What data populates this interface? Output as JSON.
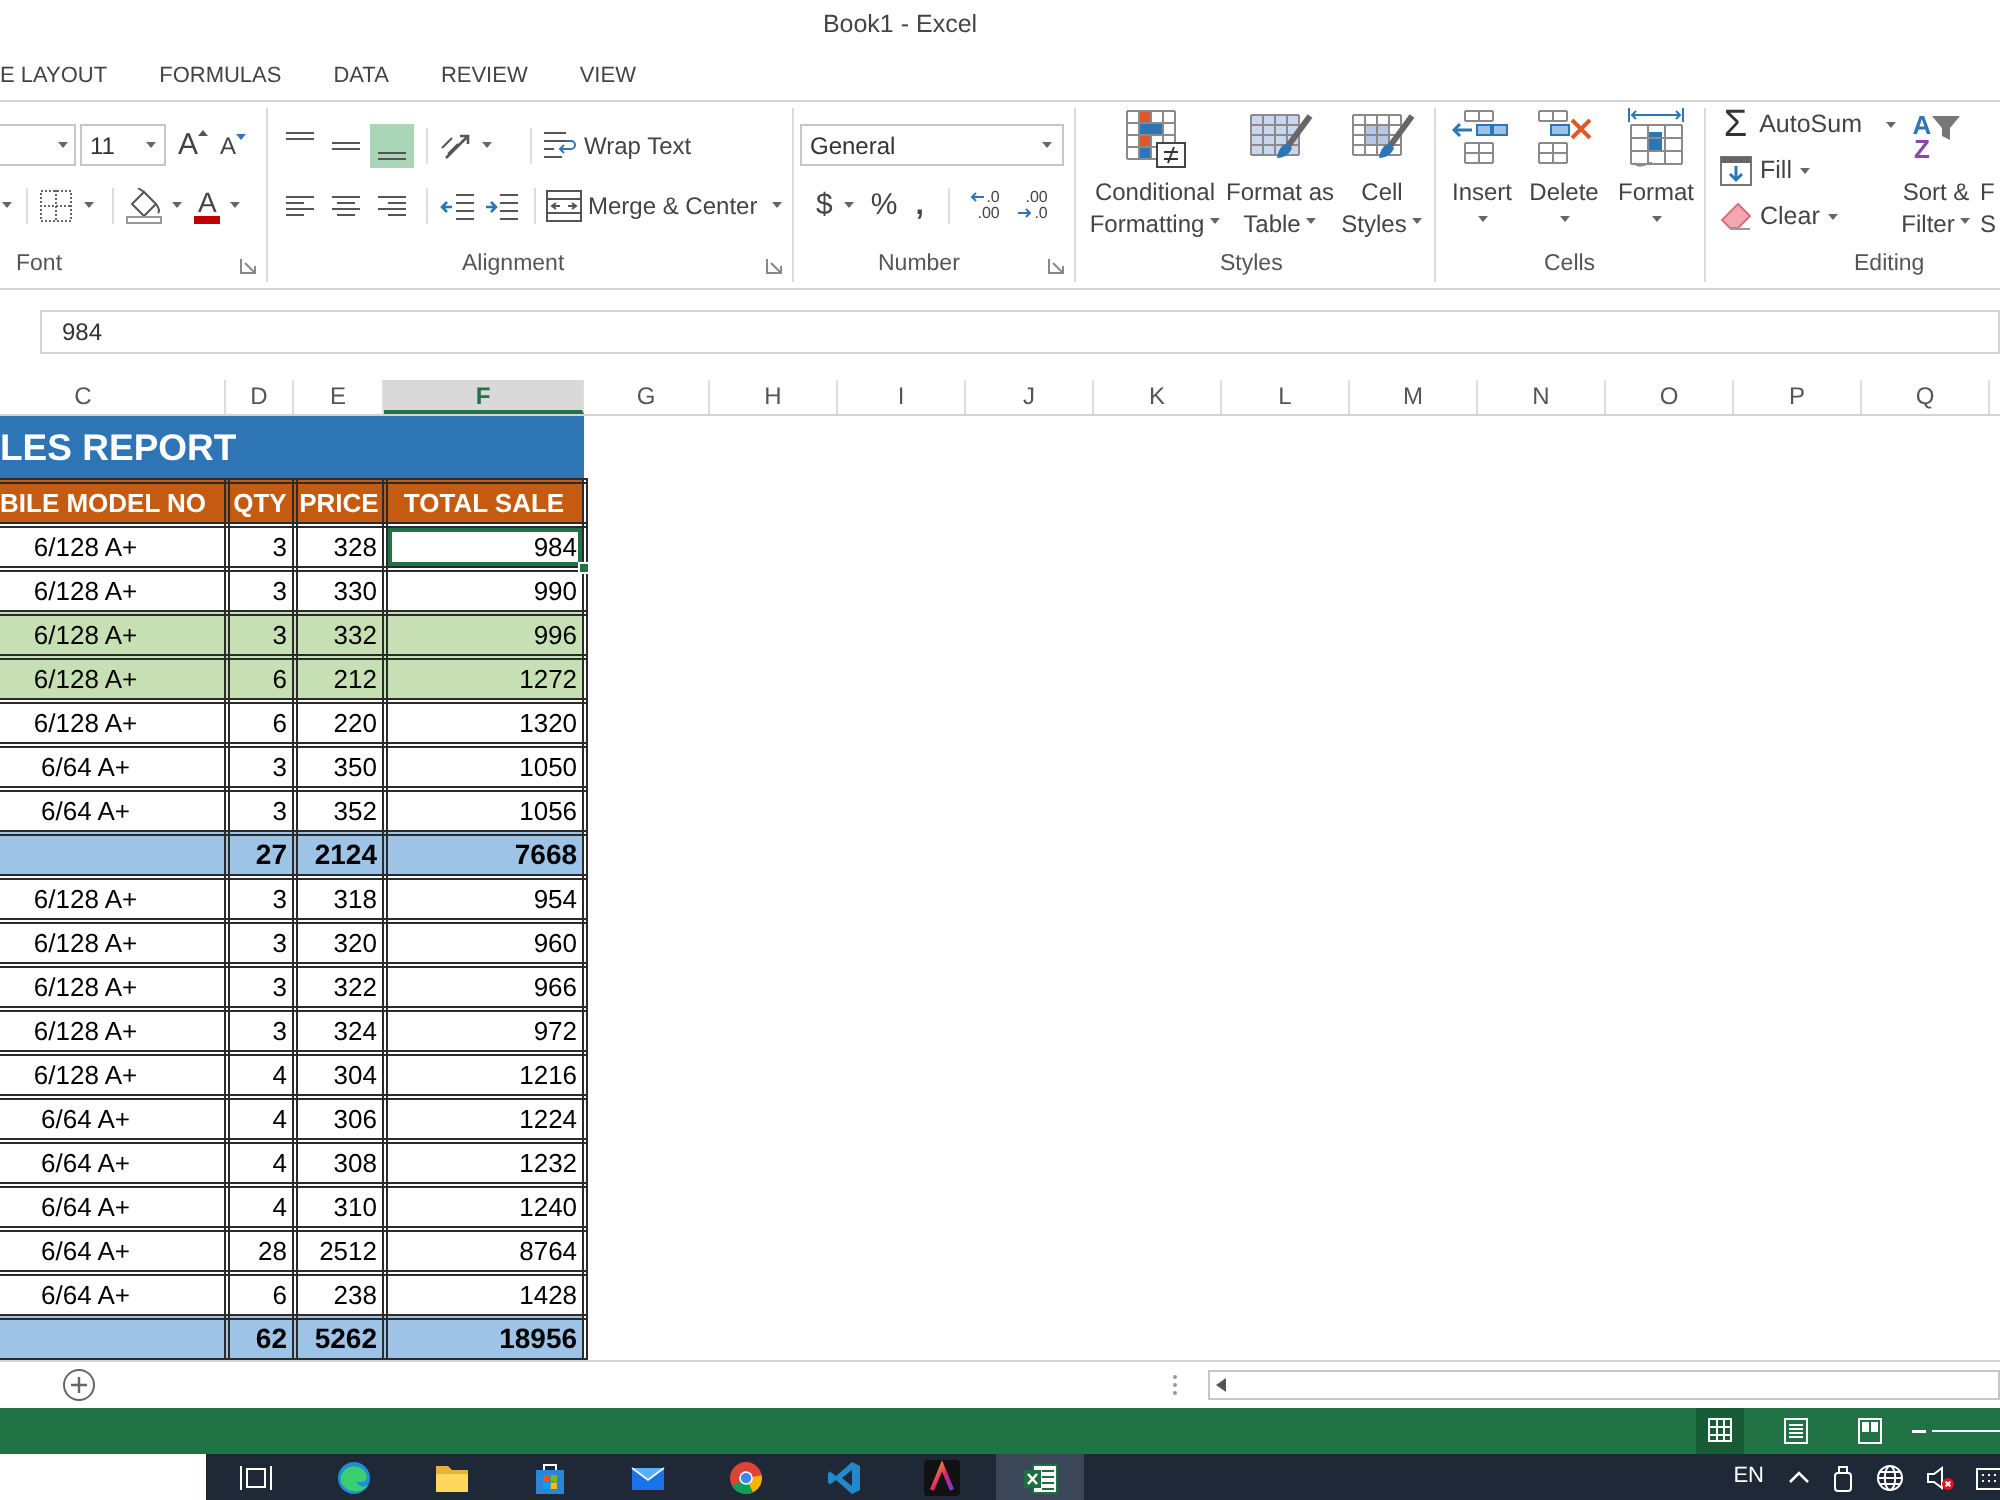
{
  "window": {
    "title": "Book1 - Excel"
  },
  "tabs": [
    {
      "label": "E LAYOUT",
      "selected": false
    },
    {
      "label": "FORMULAS",
      "selected": false
    },
    {
      "label": "DATA",
      "selected": false
    },
    {
      "label": "REVIEW",
      "selected": false
    },
    {
      "label": "VIEW",
      "selected": false
    }
  ],
  "ribbon": {
    "font": {
      "label": "Font",
      "size": "11",
      "grow_glyph": "A",
      "shrink_glyph": "A",
      "color_glyph": "A"
    },
    "alignment": {
      "label": "Alignment",
      "vertical": [
        {
          "kind": "top",
          "selected": false
        },
        {
          "kind": "middle",
          "selected": false
        },
        {
          "kind": "bottom",
          "selected": true
        }
      ],
      "horizontal": [
        {
          "kind": "left",
          "selected": false
        },
        {
          "kind": "center",
          "selected": false
        },
        {
          "kind": "right",
          "selected": false
        }
      ],
      "wrap_text": "Wrap Text",
      "merge": "Merge & Center"
    },
    "number": {
      "label": "Number",
      "format": "General",
      "currency": "$",
      "percent": "%",
      "comma": ",",
      "increase_decimal": [
        ".0",
        ".00"
      ],
      "decrease_decimal": [
        ".00",
        ".0"
      ]
    },
    "styles": {
      "label": "Styles",
      "buttons": [
        {
          "kind": "conditional",
          "lines": [
            "Conditional",
            "Formatting"
          ]
        },
        {
          "kind": "table",
          "lines": [
            "Format as",
            "Table"
          ]
        },
        {
          "kind": "cell",
          "lines": [
            "Cell",
            "Styles"
          ]
        }
      ]
    },
    "cells": {
      "label": "Cells",
      "buttons": [
        {
          "kind": "insert",
          "label": "Insert"
        },
        {
          "kind": "delete",
          "label": "Delete"
        },
        {
          "kind": "format",
          "label": "Format"
        }
      ]
    },
    "editing": {
      "label": "Editing",
      "autosum_glyph": "Σ",
      "autosum": "AutoSum",
      "fill": "Fill",
      "clear": "Clear",
      "sort_glyphs": [
        "A",
        "Z"
      ],
      "sort_lines": [
        "Sort &",
        "Filter"
      ],
      "cut_lines": [
        "F",
        "S"
      ]
    }
  },
  "formula_bar": {
    "value": "984"
  },
  "columns": [
    {
      "label": "C",
      "selected": false
    },
    {
      "label": "D",
      "selected": false
    },
    {
      "label": "E",
      "selected": false
    },
    {
      "label": "F",
      "selected": true
    },
    {
      "label": "G",
      "selected": false
    },
    {
      "label": "H",
      "selected": false
    },
    {
      "label": "I",
      "selected": false
    },
    {
      "label": "J",
      "selected": false
    },
    {
      "label": "K",
      "selected": false
    },
    {
      "label": "L",
      "selected": false
    },
    {
      "label": "M",
      "selected": false
    },
    {
      "label": "N",
      "selected": false
    },
    {
      "label": "O",
      "selected": false
    },
    {
      "label": "P",
      "selected": false
    },
    {
      "label": "Q",
      "selected": false
    }
  ],
  "sheet": {
    "title": "LES REPORT",
    "headers": [
      "BILE MODEL NO",
      "QTY",
      "PRICE",
      "TOTAL SALE"
    ],
    "rows": [
      {
        "kind": "plain",
        "model": "6/128 A+",
        "qty": "3",
        "price": "328",
        "total_sale": "984",
        "selected": true
      },
      {
        "kind": "plain",
        "model": "6/128 A+",
        "qty": "3",
        "price": "330",
        "total_sale": "990",
        "selected": false
      },
      {
        "kind": "highlight",
        "model": "6/128 A+",
        "qty": "3",
        "price": "332",
        "total_sale": "996",
        "selected": false
      },
      {
        "kind": "highlight",
        "model": "6/128 A+",
        "qty": "6",
        "price": "212",
        "total_sale": "1272",
        "selected": false
      },
      {
        "kind": "plain",
        "model": "6/128 A+",
        "qty": "6",
        "price": "220",
        "total_sale": "1320",
        "selected": false
      },
      {
        "kind": "plain",
        "model": "6/64 A+",
        "qty": "3",
        "price": "350",
        "total_sale": "1050",
        "selected": false
      },
      {
        "kind": "plain",
        "model": "6/64 A+",
        "qty": "3",
        "price": "352",
        "total_sale": "1056",
        "selected": false
      },
      {
        "kind": "total",
        "qty": "27",
        "price": "2124",
        "total_sale": "7668",
        "selected": false
      },
      {
        "kind": "plain",
        "model": "6/128 A+",
        "qty": "3",
        "price": "318",
        "total_sale": "954",
        "selected": false
      },
      {
        "kind": "plain",
        "model": "6/128 A+",
        "qty": "3",
        "price": "320",
        "total_sale": "960",
        "selected": false
      },
      {
        "kind": "plain",
        "model": "6/128 A+",
        "qty": "3",
        "price": "322",
        "total_sale": "966",
        "selected": false
      },
      {
        "kind": "plain",
        "model": "6/128 A+",
        "qty": "3",
        "price": "324",
        "total_sale": "972",
        "selected": false
      },
      {
        "kind": "plain",
        "model": "6/128 A+",
        "qty": "4",
        "price": "304",
        "total_sale": "1216",
        "selected": false
      },
      {
        "kind": "plain",
        "model": "6/64 A+",
        "qty": "4",
        "price": "306",
        "total_sale": "1224",
        "selected": false
      },
      {
        "kind": "plain",
        "model": "6/64 A+",
        "qty": "4",
        "price": "308",
        "total_sale": "1232",
        "selected": false
      },
      {
        "kind": "plain",
        "model": "6/64 A+",
        "qty": "4",
        "price": "310",
        "total_sale": "1240",
        "selected": false
      },
      {
        "kind": "plain",
        "model": "6/64 A+",
        "qty": "28",
        "price": "2512",
        "total_sale": "8764",
        "selected": false
      },
      {
        "kind": "plain",
        "model": "6/64 A+",
        "qty": "6",
        "price": "238",
        "total_sale": "1428",
        "selected": false
      },
      {
        "kind": "total",
        "qty": "62",
        "price": "5262",
        "total_sale": "18956",
        "selected": false
      }
    ]
  },
  "status_bar": {
    "views": [
      {
        "kind": "normal",
        "selected": true
      },
      {
        "kind": "page_layout",
        "selected": false
      },
      {
        "kind": "page_break",
        "selected": false
      }
    ]
  },
  "taskbar": {
    "apps": [
      {
        "kind": "task_view",
        "active": false
      },
      {
        "kind": "edge",
        "active": false
      },
      {
        "kind": "folder",
        "active": false
      },
      {
        "kind": "store",
        "active": false
      },
      {
        "kind": "mail",
        "active": false
      },
      {
        "kind": "chrome",
        "active": false
      },
      {
        "kind": "code",
        "active": false
      },
      {
        "kind": "app",
        "active": false
      },
      {
        "kind": "excel",
        "active": true
      }
    ],
    "language": "EN"
  }
}
